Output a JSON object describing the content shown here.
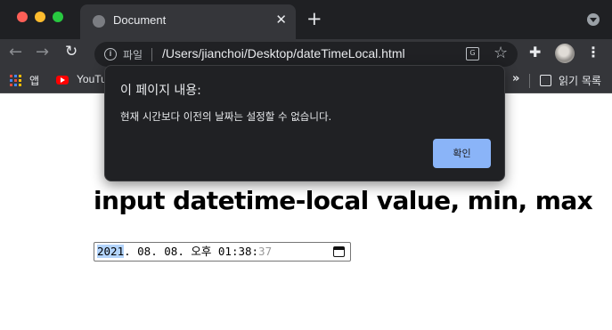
{
  "browser": {
    "tab": {
      "title": "Document",
      "close_glyph": "✕",
      "favicon": "globe-icon"
    },
    "new_tab_glyph": "+",
    "toolbar": {
      "back_glyph": "←",
      "forward_glyph": "→",
      "reload_glyph": "↻",
      "scheme_label": "파일",
      "url": "/Users/jianchoi/Desktop/dateTimeLocal.html",
      "star_glyph": "☆",
      "extensions_glyph": "✚",
      "menu_glyph": "⋮"
    },
    "bookmarks": {
      "apps_label": "앱",
      "youtube_label": "YouTu",
      "more_glyph": "»",
      "reading_list_label": "읽기 목록"
    }
  },
  "page": {
    "heading": "input datetime-local value, min, max",
    "datetime_input": {
      "year": "2021",
      "rest": ". 08. 08. 오후 01:38:",
      "seconds": "37"
    }
  },
  "dialog": {
    "title": "이 페이지 내용:",
    "message": "현재 시간보다 이전의 날짜는 설정할 수 없습니다.",
    "ok_label": "확인"
  },
  "colors": {
    "dialog_bg": "#202124",
    "ok_button": "#8ab4f8",
    "toolbar_bg": "#35363a",
    "titlebar_bg": "#1f2023"
  }
}
